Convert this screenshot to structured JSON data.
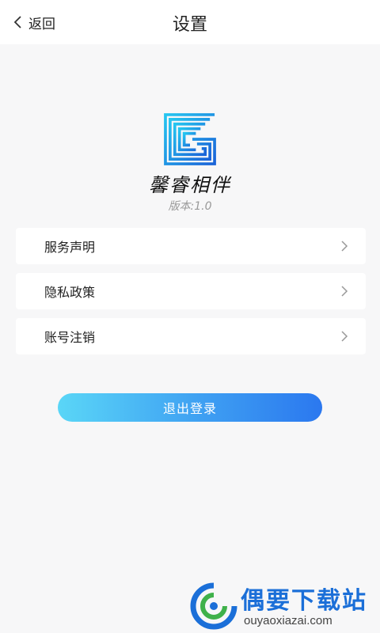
{
  "header": {
    "back_label": "返回",
    "title": "设置"
  },
  "app": {
    "name": "馨睿相伴",
    "version": "版本:1.0"
  },
  "menu": {
    "items": [
      {
        "label": "服务声明"
      },
      {
        "label": "隐私政策"
      },
      {
        "label": "账号注销"
      }
    ]
  },
  "logout": {
    "label": "退出登录"
  },
  "watermark": {
    "name": "偶要下载站",
    "url": "ouyaoxiazai.com"
  },
  "colors": {
    "accent_start": "#5ad6f7",
    "accent_end": "#2b78ef",
    "background": "#f7f7f8"
  }
}
